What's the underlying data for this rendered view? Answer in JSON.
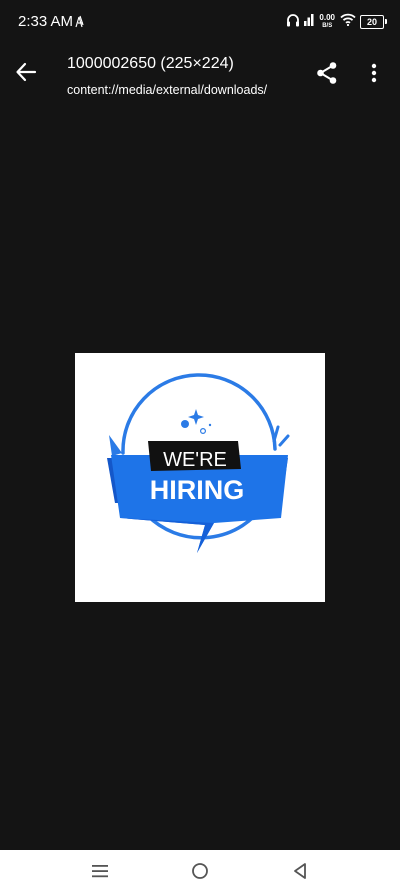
{
  "status_bar": {
    "time": "2:33 AM",
    "net_speed_value": "0.00",
    "net_speed_unit": "B/S",
    "battery_level": "20",
    "icons": [
      "notification-icon",
      "headphones-icon",
      "signal-icon",
      "wifi-icon",
      "battery-icon"
    ]
  },
  "app_bar": {
    "title": "1000002650 (225×224)",
    "subtitle": "content://media/external/downloads/",
    "icons": [
      "back-arrow-icon",
      "share-icon",
      "more-vert-icon"
    ]
  },
  "image": {
    "line1": "WE'RE",
    "line2": "HIRING",
    "colors": {
      "ribbon": "#1e74e8",
      "ribbon_dark": "#1457c9",
      "banner_black": "#111111",
      "accent": "#2b7be6"
    }
  },
  "nav_bar": {
    "icons": [
      "menu-icon",
      "home-icon",
      "back-icon"
    ]
  }
}
